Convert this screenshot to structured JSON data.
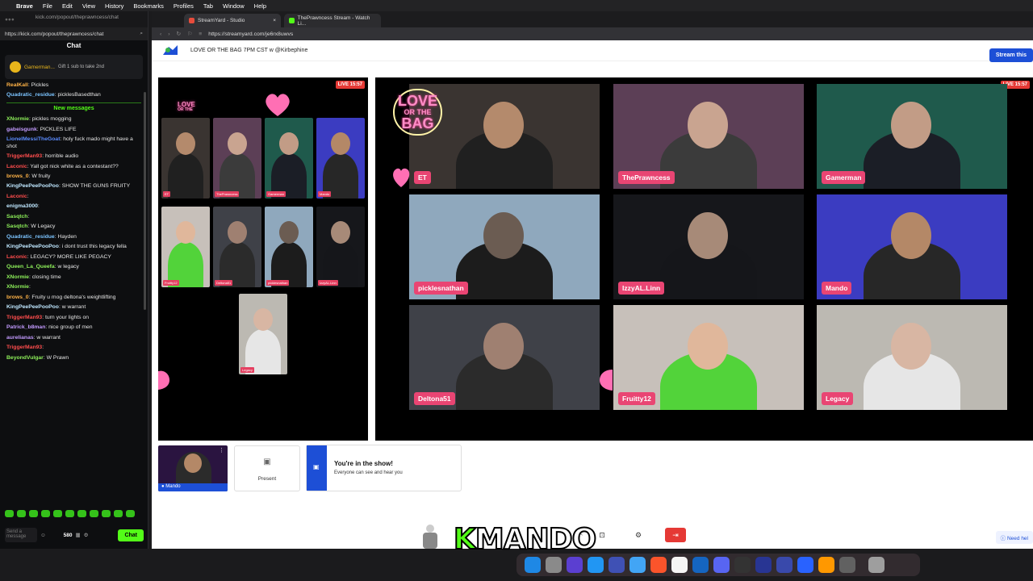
{
  "menubar": {
    "apple": "",
    "items": [
      "Brave",
      "File",
      "Edit",
      "View",
      "History",
      "Bookmarks",
      "Profiles",
      "Tab",
      "Window",
      "Help"
    ]
  },
  "kick": {
    "tab_title": "kick.com/popout/theprawncess/chat",
    "url": "https://kick.com/popout/theprawncess/chat",
    "header": "Chat",
    "pinned_user": "Gamerman...",
    "pinned_text": "Gift 1 sub to take 2nd",
    "new_messages": "New messages",
    "messages": [
      {
        "user": "RealKall",
        "color": "#ffb347",
        "text": "Pickles"
      },
      {
        "user": "Quadratic_residue",
        "color": "#7cc4ff",
        "text": "picklesBasedthan"
      },
      {
        "user": "XNormie",
        "color": "#8ef05a",
        "text": "pickles mogging"
      },
      {
        "user": "gabeisgunk",
        "color": "#c39bff",
        "text": "PICKLES LIFE"
      },
      {
        "user": "LionelMessiTheGoat",
        "color": "#5b8cff",
        "text": "holy fuck mado might have a shot"
      },
      {
        "user": "TriggerMan93",
        "color": "#ff4d4d",
        "text": "horrible audio"
      },
      {
        "user": "Laconic",
        "color": "#ff4d4d",
        "text": "Yall got nick white as a contestant??"
      },
      {
        "user": "brows_0",
        "color": "#ffb347",
        "text": "W fruity"
      },
      {
        "user": "KingPeePeePooPoo",
        "color": "#bfe7ff",
        "text": "SHOW THE GUNS FRUITY"
      },
      {
        "user": "Laconic",
        "color": "#ff4d4d",
        "text": ""
      },
      {
        "user": "enigma3000",
        "color": "#bfe7ff",
        "text": ""
      },
      {
        "user": "Sasqtch",
        "color": "#8ef05a",
        "text": ""
      },
      {
        "user": "Sasqtch",
        "color": "#8ef05a",
        "text": "W Legacy"
      },
      {
        "user": "Quadratic_residue",
        "color": "#7cc4ff",
        "text": "Hayden"
      },
      {
        "user": "KingPeePeePooPoo",
        "color": "#bfe7ff",
        "text": "i dont trust this legacy fella"
      },
      {
        "user": "Laconic",
        "color": "#ff4d4d",
        "text": "LEGACY? MORE LIKE PEGACY"
      },
      {
        "user": "Queen_La_Queefa",
        "color": "#8ef05a",
        "text": "w legacy"
      },
      {
        "user": "XNormie",
        "color": "#8ef05a",
        "text": "closing time"
      },
      {
        "user": "XNormie",
        "color": "#8ef05a",
        "text": ""
      },
      {
        "user": "brows_0",
        "color": "#ffb347",
        "text": "Fruity u mog deltona's weightlifting"
      },
      {
        "user": "KingPeePeePooPoo",
        "color": "#bfe7ff",
        "text": "w warrant"
      },
      {
        "user": "TriggerMan93",
        "color": "#ff4d4d",
        "text": "turn your lights on"
      },
      {
        "user": "Patrick_b8man",
        "color": "#c39bff",
        "text": "nice group of men"
      },
      {
        "user": "aurelianas",
        "color": "#c39bff",
        "text": "w warrant"
      },
      {
        "user": "TriggerMan93",
        "color": "#ff4d4d",
        "text": ""
      },
      {
        "user": "BeyondVulgar",
        "color": "#8ef05a",
        "text": "W Prawn"
      }
    ],
    "send_placeholder": "Send a message",
    "points": "580",
    "chat_button": "Chat"
  },
  "streamyard": {
    "tabs": [
      {
        "label": "StreamYard - Studio",
        "favicon_color": "#e74c3c"
      },
      {
        "label": "ThePrawncess Stream - Watch Li...",
        "favicon_color": "#53fc18"
      }
    ],
    "url": "https://streamyard.com/je6rx8uwvs",
    "broadcast_title": "LOVE OR THE BAG 7PM CST w @Kirbephine",
    "stream_button": "Stream this",
    "live_badge": "LIVE 15:57",
    "tiles": [
      {
        "name": "ET",
        "bg": "#3a3431",
        "skin": "#b48a6c",
        "shirt": "#202020"
      },
      {
        "name": "ThePrawncess",
        "bg": "#5c3f56",
        "skin": "#c9a490",
        "shirt": "#3b3b3b"
      },
      {
        "name": "Gamerman",
        "bg": "#1f5a4c",
        "skin": "#c29c86",
        "shirt": "#1b1e26"
      },
      {
        "name": "picklesnathan",
        "bg": "#8fa8bd",
        "skin": "#6b5c52",
        "shirt": "#1c1c1c"
      },
      {
        "name": "IzzyAL.Linn",
        "bg": "#16171b",
        "skin": "#a78a78",
        "shirt": "#15161a"
      },
      {
        "name": "Mando",
        "bg": "#3b3cc1",
        "skin": "#b48867",
        "shirt": "#272727"
      },
      {
        "name": "Deltona51",
        "bg": "#3f4148",
        "skin": "#9f8071",
        "shirt": "#2b2b2b"
      },
      {
        "name": "Fruitty12",
        "bg": "#c7c0ba",
        "skin": "#e0b79b",
        "shirt": "#52d33a"
      },
      {
        "name": "Legacy",
        "bg": "#bcb9b2",
        "skin": "#d8b6a3",
        "shirt": "#e6e6e6"
      }
    ],
    "show_title": "You're in the show!",
    "show_sub": "Everyone can see and hear you",
    "present_label": "Present",
    "self_name": "Mando",
    "overlay_text": "MANDO",
    "overlay_k": "K",
    "help_label": "Need hel",
    "love_logo": [
      "LOVE",
      "OR THE",
      "BAG"
    ]
  }
}
